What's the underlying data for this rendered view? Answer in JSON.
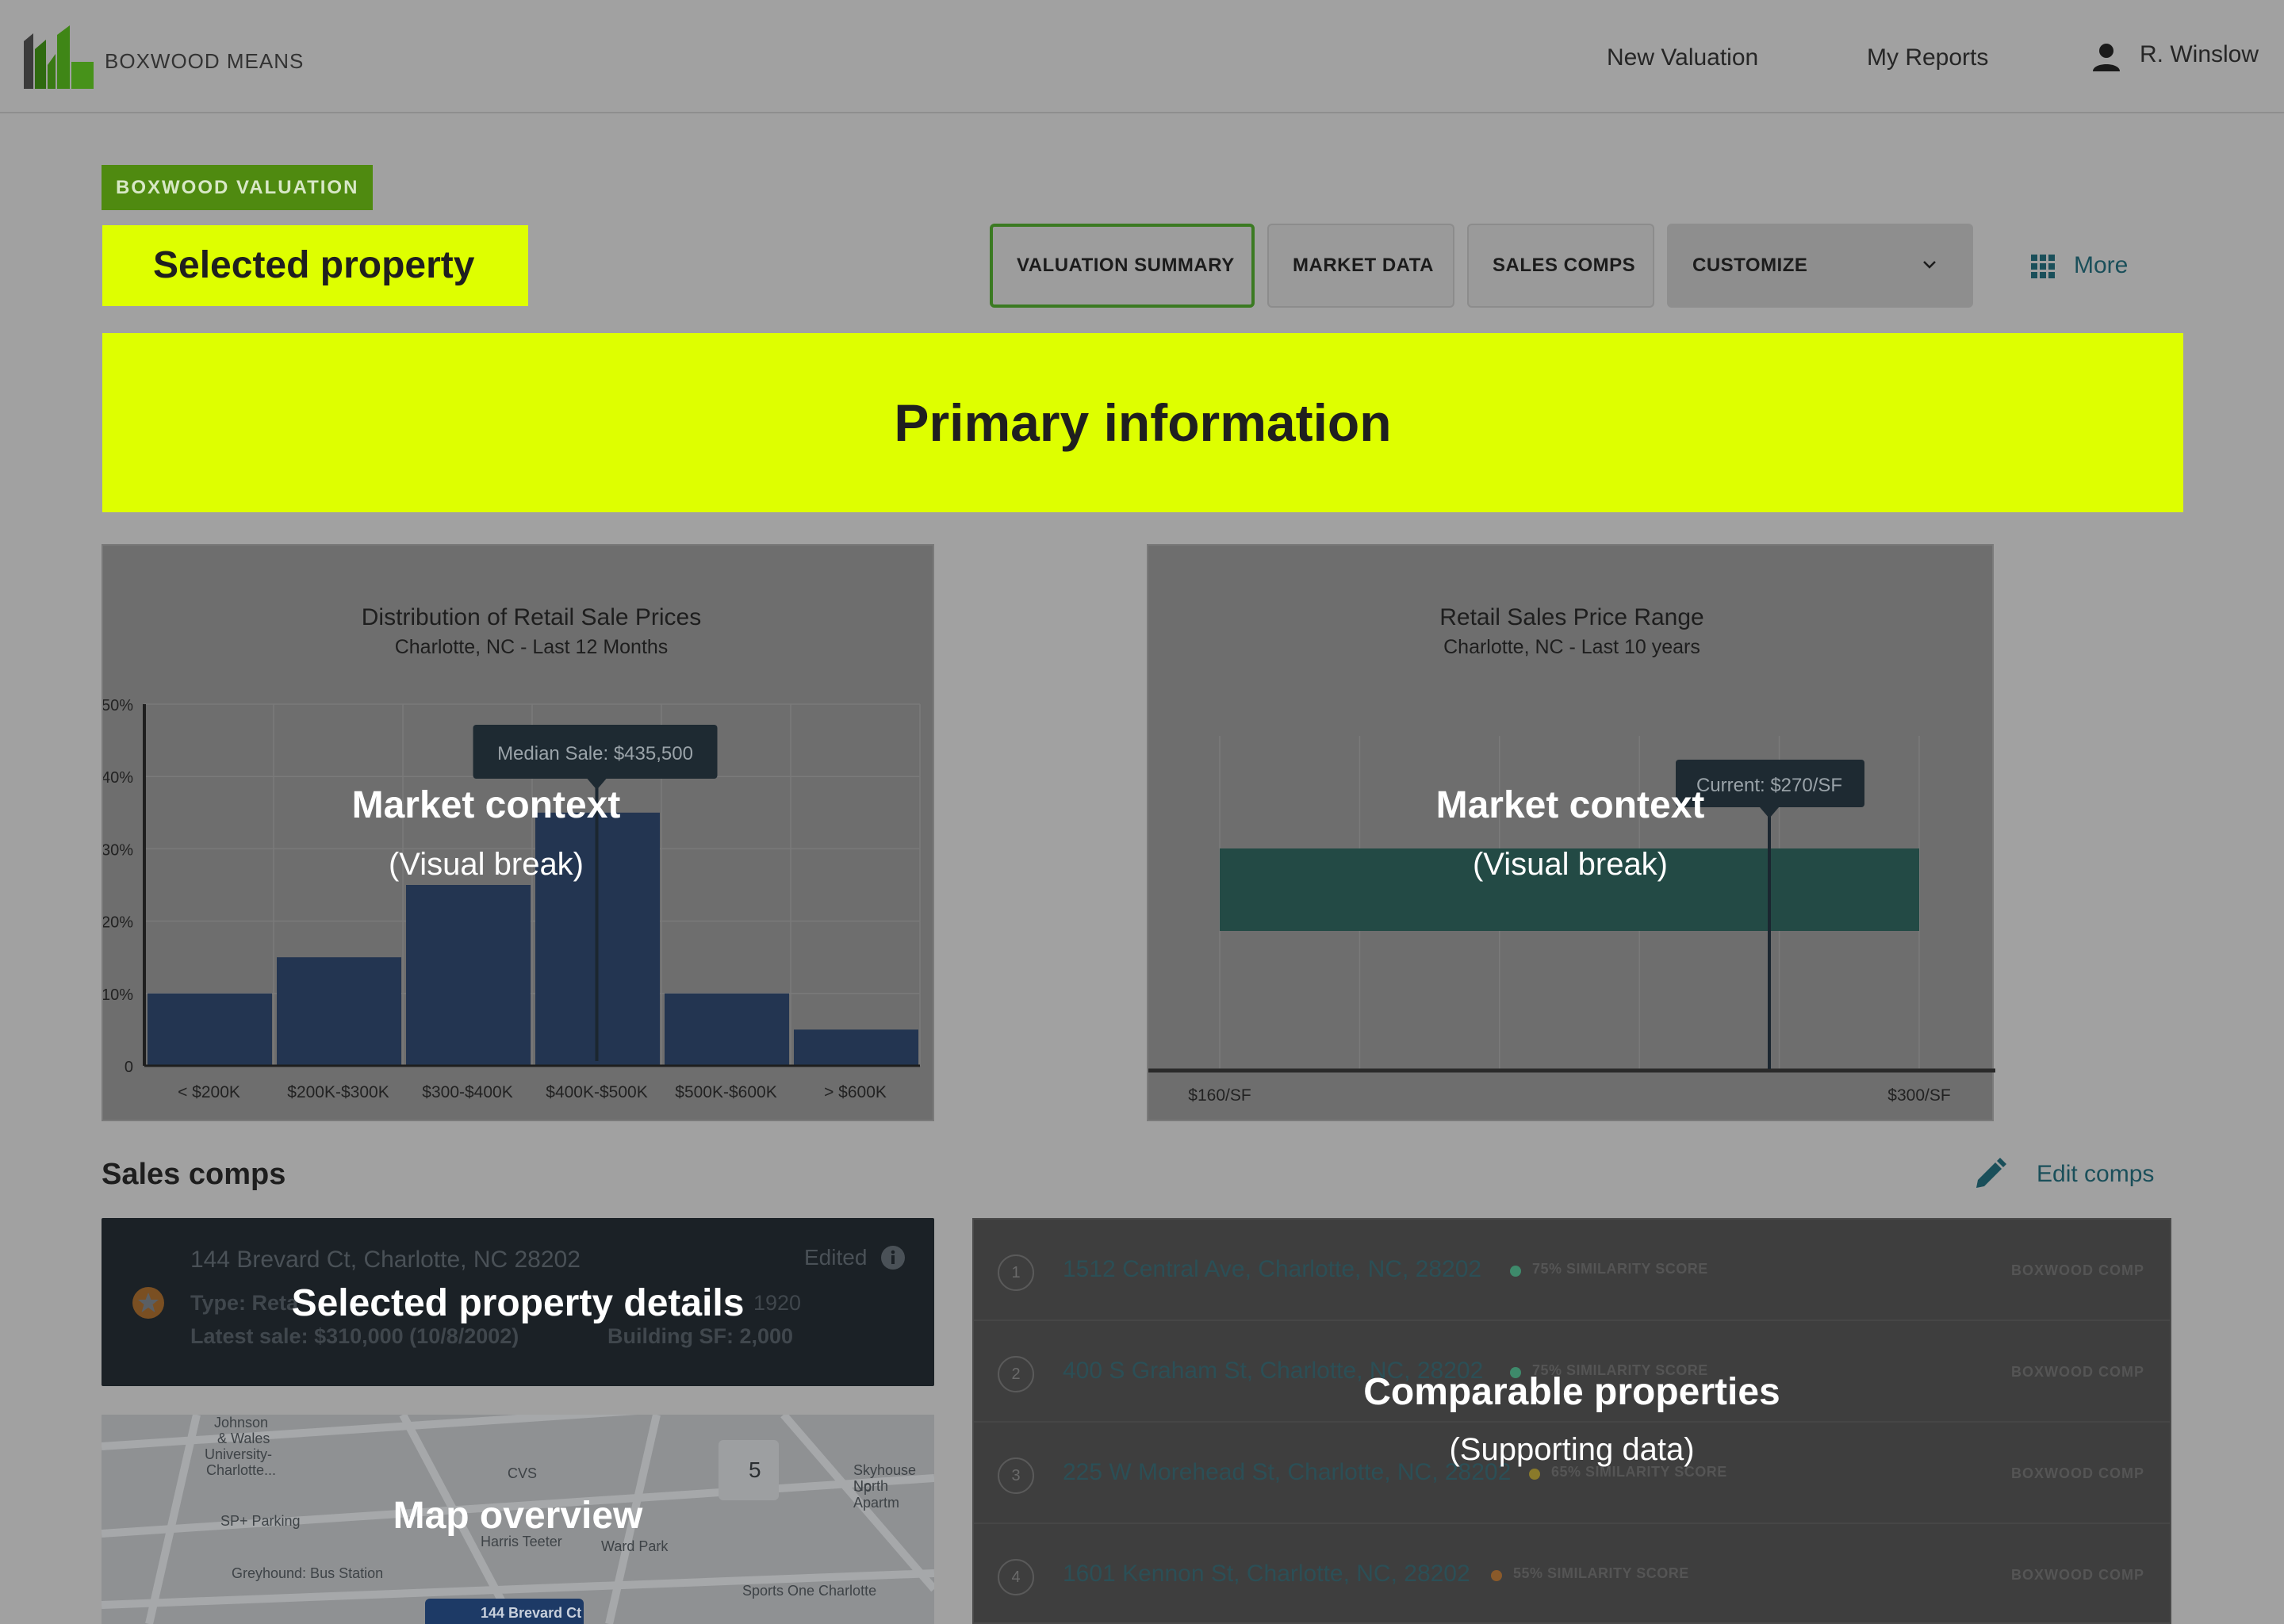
{
  "header": {
    "brand": "BOXWOOD MEANS",
    "nav": [
      {
        "label": "New Valuation"
      },
      {
        "label": "My Reports"
      }
    ],
    "user_name": "R. Winslow"
  },
  "badge": "BOXWOOD VALUATION",
  "selected_property_label": "Selected property",
  "tabs": [
    {
      "label": "VALUATION SUMMARY",
      "active": true
    },
    {
      "label": "MARKET DATA"
    },
    {
      "label": "SALES COMPS"
    },
    {
      "label": "CUSTOMIZE"
    }
  ],
  "more_label": "More",
  "primary_label": "Primary information",
  "market_overlay": {
    "title": "Market context",
    "subtitle": "(Visual break)"
  },
  "chart_data": [
    {
      "type": "bar",
      "title": "Distribution of Retail Sale Prices",
      "subtitle": "Charlotte, NC - Last 12 Months",
      "categories": [
        "< $200K",
        "$200K-$300K",
        "$300-$400K",
        "$400K-$500K",
        "$500K-$600K",
        "> $600K"
      ],
      "values": [
        10,
        15,
        25,
        35,
        10,
        5
      ],
      "yticks": [
        "0",
        "10%",
        "20%",
        "30%",
        "40%",
        "50%"
      ],
      "ylim": [
        0,
        50
      ],
      "annotation": {
        "label": "Median Sale: $435,500",
        "category_position": 3.5
      },
      "grid": true,
      "color": "#233551"
    },
    {
      "type": "bar",
      "title": "Retail Sales Price Range",
      "subtitle": "Charlotte, NC - Last 10 years",
      "range": {
        "min": 160,
        "max": 300
      },
      "bar_range": [
        160,
        300
      ],
      "current": 270,
      "annotation": {
        "label": "Current: $270/SF"
      },
      "xtick_labels": [
        "$160/SF",
        "$300/SF"
      ],
      "grid": true,
      "color": "#234a45"
    }
  ],
  "sales_comps": {
    "title": "Sales comps",
    "edit_label": "Edit comps",
    "selected": {
      "address": "144 Brevard Ct, Charlotte, NC 28202",
      "edited": "Edited",
      "type": "Type: Reta",
      "year": "1920",
      "latest_sale": "Latest sale: $310,000 (10/8/2002)",
      "building_sf": "Building SF: 2,000",
      "overlay": "Selected property details"
    },
    "map": {
      "overlay": "Map overview",
      "cluster_count": "5",
      "labels": [
        "Johnson",
        "& Wales",
        "University-",
        "Charlotte...",
        "SP+ Parking",
        "Greyhound: Bus Station",
        "CVS",
        "Skyhouse Up",
        "North Apartm",
        "Sports One Charlotte",
        "144 Brevard Ct",
        "Harris Teeter",
        "Ward Park"
      ]
    },
    "comparables": {
      "overlay_title": "Comparable properties",
      "overlay_subtitle": "(Supporting data)",
      "rows": [
        {
          "num": "1",
          "address": "1512 Central Ave, Charlotte, NC, 28202",
          "score": "75% SIMILARITY SCORE",
          "tag": "BOXWOOD COMP",
          "dot": "#3e8a6b"
        },
        {
          "num": "2",
          "address": "400 S Graham St, Charlotte, NC, 28202",
          "score": "75% SIMILARITY SCORE",
          "tag": "BOXWOOD COMP",
          "dot": "#3e8a6b"
        },
        {
          "num": "3",
          "address": "225 W Morehead St, Charlotte, NC, 28202",
          "score": "65% SIMILARITY SCORE",
          "tag": "BOXWOOD COMP",
          "dot": "#8a7a2a"
        },
        {
          "num": "4",
          "address": "1601 Kennon St, Charlotte, NC, 28202",
          "score": "55% SIMILARITY SCORE",
          "tag": "BOXWOOD COMP",
          "dot": "#8a5a2a"
        }
      ]
    }
  }
}
